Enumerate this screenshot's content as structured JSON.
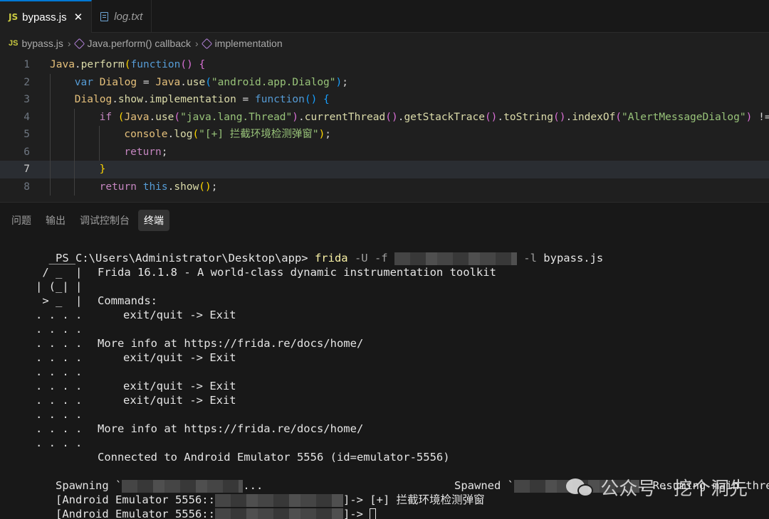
{
  "tabs": [
    {
      "badge": "JS",
      "label": "bypass.js",
      "close": "✕"
    },
    {
      "label": "log.txt"
    }
  ],
  "breadcrumb": {
    "badge": "JS",
    "items": [
      "bypass.js",
      "Java.perform() callback",
      "implementation"
    ],
    "separator": "›"
  },
  "editor": {
    "line_numbers": [
      "1",
      "2",
      "3",
      "4",
      "5",
      "6",
      "7",
      "8"
    ],
    "current_line": "7",
    "lines": [
      [
        [
          "obj",
          "Java"
        ],
        [
          "white",
          "."
        ],
        [
          "fn",
          "perform"
        ],
        [
          "paren",
          "("
        ],
        [
          "kw",
          "function"
        ],
        [
          "paren2",
          "()"
        ],
        [
          "white",
          " "
        ],
        [
          "paren2",
          "{"
        ]
      ],
      [
        [
          "kw",
          "var"
        ],
        [
          "white",
          " "
        ],
        [
          "obj",
          "Dialog"
        ],
        [
          "white",
          " = "
        ],
        [
          "obj",
          "Java"
        ],
        [
          "white",
          "."
        ],
        [
          "fn",
          "use"
        ],
        [
          "paren3",
          "("
        ],
        [
          "str2",
          "\"android.app.Dialog\""
        ],
        [
          "paren3",
          ")"
        ],
        [
          "white",
          ";"
        ]
      ],
      [
        [
          "obj",
          "Dialog"
        ],
        [
          "white",
          "."
        ],
        [
          "fn",
          "show"
        ],
        [
          "white",
          "."
        ],
        [
          "fn",
          "implementation"
        ],
        [
          "white",
          " = "
        ],
        [
          "kw",
          "function"
        ],
        [
          "paren3",
          "()"
        ],
        [
          "white",
          " "
        ],
        [
          "paren3",
          "{"
        ]
      ],
      [
        [
          "ctl",
          "if"
        ],
        [
          "white",
          " "
        ],
        [
          "paren",
          "("
        ],
        [
          "obj",
          "Java"
        ],
        [
          "white",
          "."
        ],
        [
          "fn",
          "use"
        ],
        [
          "paren2",
          "("
        ],
        [
          "str2",
          "\"java.lang.Thread\""
        ],
        [
          "paren2",
          ")"
        ],
        [
          "white",
          "."
        ],
        [
          "fn",
          "currentThread"
        ],
        [
          "paren2",
          "()"
        ],
        [
          "white",
          "."
        ],
        [
          "fn",
          "getStackTrace"
        ],
        [
          "paren2",
          "()"
        ],
        [
          "white",
          "."
        ],
        [
          "fn",
          "toString"
        ],
        [
          "paren2",
          "()"
        ],
        [
          "white",
          "."
        ],
        [
          "fn",
          "indexOf"
        ],
        [
          "paren2",
          "("
        ],
        [
          "str2",
          "\"AlertMessageDialog\""
        ],
        [
          "paren2",
          ")"
        ],
        [
          "white",
          " !=="
        ]
      ],
      [
        [
          "obj",
          "console"
        ],
        [
          "white",
          "."
        ],
        [
          "fn",
          "log"
        ],
        [
          "paren",
          "("
        ],
        [
          "str2",
          "\"[+] 拦截环境检测弹窗\""
        ],
        [
          "paren",
          ")"
        ],
        [
          "white",
          ";"
        ]
      ],
      [
        [
          "ctl",
          "return"
        ],
        [
          "white",
          ";"
        ]
      ],
      [
        [
          "paren",
          "}"
        ]
      ],
      [
        [
          "ctl",
          "return"
        ],
        [
          "white",
          " "
        ],
        [
          "kw",
          "this"
        ],
        [
          "white",
          "."
        ],
        [
          "fn",
          "show"
        ],
        [
          "paren",
          "()"
        ],
        [
          "white",
          ";"
        ]
      ]
    ]
  },
  "panel": {
    "tabs": [
      "问题",
      "输出",
      "调试控制台",
      "终端"
    ],
    "active_tab": "终端"
  },
  "terminal": {
    "prompt": "PS C:\\Users\\Administrator\\Desktop\\app> ",
    "cmd": "frida",
    "flags1": " -U -f ",
    "flags2": " -l ",
    "script": "bypass.js",
    "logo": [
      "     ____",
      "    / _  |",
      "   | (_| |",
      "    > _  |",
      "   . . . .",
      "   . . . .",
      "   . . . .",
      "   . . . .",
      "   . . . .",
      "   . . . .",
      "   . . . .",
      "   . . . .",
      "   . . . .",
      "   . . . ."
    ],
    "banner": "Frida 16.1.8 - A world-class dynamic instrumentation toolkit",
    "commands": "Commands:",
    "exit": "exit/quit -> Exit",
    "more_info": "More info at https://frida.re/docs/home/",
    "connected": "Connected to Android Emulator 5556 (id=emulator-5556)",
    "spawning": "Spawning `",
    "spawning_end": "...",
    "spawned": "Spawned `",
    "resuming": ". Resuming main thread!",
    "log_prefix": "[Android Emulator 5556::",
    "log_msg": "]-> [+] 拦截环境检测弹窗",
    "log_end": "]-> "
  },
  "watermark": {
    "text": "公众号 · 挖个洞先",
    "icon": "wechat-icon"
  }
}
